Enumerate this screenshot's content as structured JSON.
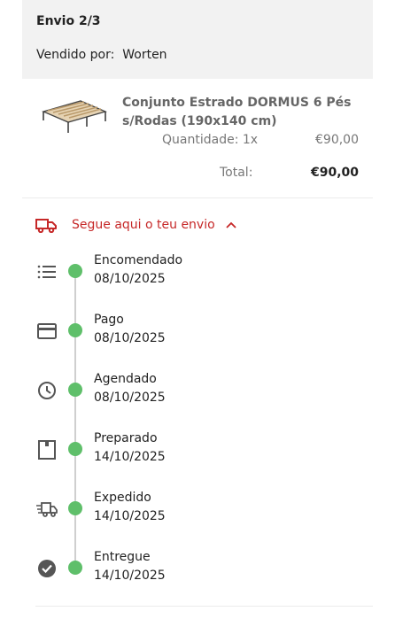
{
  "shipment": {
    "title": "Envio 2/3",
    "seller_text": "Vendido por:  Worten"
  },
  "product": {
    "name": "Conjunto Estrado DORMUS 6 Pés s/Rodas (190x140 cm)",
    "quantity": "Quantidade: 1x",
    "price": "€90,00",
    "total_label": "Total:",
    "total_value": "€90,00"
  },
  "tracking": {
    "toggle_label": "Segue aqui o teu envio",
    "accent_color": "#c62828",
    "dot_color": "#5fbf6a",
    "steps": [
      {
        "label": "Encomendado",
        "date": "08/10/2025",
        "icon": "list-icon"
      },
      {
        "label": "Pago",
        "date": "08/10/2025",
        "icon": "credit-card-icon"
      },
      {
        "label": "Agendado",
        "date": "08/10/2025",
        "icon": "clock-icon"
      },
      {
        "label": "Preparado",
        "date": "14/10/2025",
        "icon": "box-icon"
      },
      {
        "label": "Expedido",
        "date": "14/10/2025",
        "icon": "shipping-truck-icon"
      },
      {
        "label": "Entregue",
        "date": "14/10/2025",
        "icon": "check-circle-icon"
      }
    ]
  }
}
